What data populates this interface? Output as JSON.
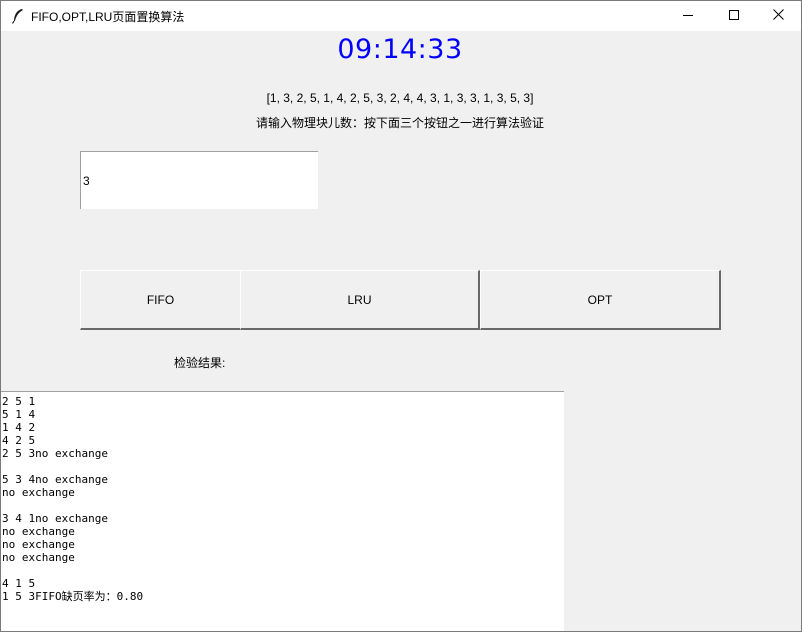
{
  "window": {
    "title": "FIFO,OPT,LRU页面置换算法",
    "icon": "feather-icon",
    "controls": [
      "minimize-icon",
      "maximize-icon",
      "close-icon"
    ]
  },
  "clock": {
    "time": "09:14:33",
    "color": "#0000ff"
  },
  "reference_string": "[1, 3, 2, 5, 1, 4, 2, 5, 3, 2, 4, 4, 3, 1, 3, 3, 1, 3, 5, 3]",
  "instruction": "请输入物理块儿数：按下面三个按钮之一进行算法验证",
  "frames_input": {
    "value": "3",
    "placeholder": ""
  },
  "buttons": {
    "fifo": "FIFO",
    "lru": "LRU",
    "opt": "OPT"
  },
  "result_label": "检验结果:",
  "output_text": "2 5 1\n5 1 4\n1 4 2\n4 2 5\n2 5 3no exchange\n\n5 3 4no exchange\nno exchange\n\n3 4 1no exchange\nno exchange\nno exchange\nno exchange\n\n4 1 5\n1 5 3FIFO缺页率为：0.80"
}
